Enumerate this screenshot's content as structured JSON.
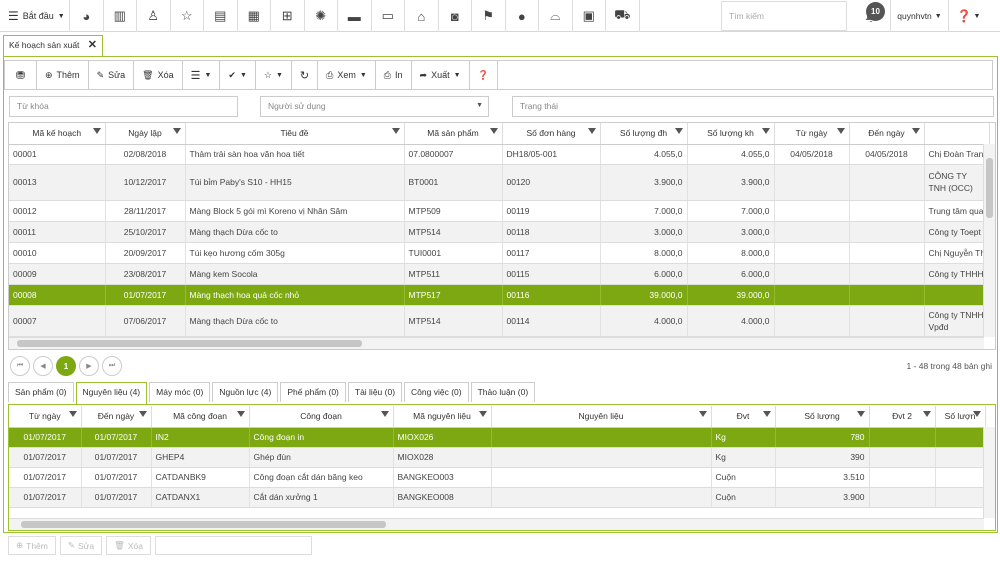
{
  "topbar": {
    "start": "Bắt đầu",
    "search_placeholder": "Tìm kiếm",
    "notifications": "10",
    "user": "quynhvtn",
    "icons": [
      "dashboard-icon",
      "bar-chart-icon",
      "person-outline-icon",
      "star-icon",
      "list-icon",
      "calendar-icon",
      "calendar-plus-icon",
      "spinner-icon",
      "card-icon",
      "credit-card-icon",
      "bank-icon",
      "money-icon",
      "bookmark-icon",
      "user-icon",
      "basket-icon",
      "briefcase-icon",
      "cart-icon"
    ]
  },
  "tab": {
    "label": "Kế hoạch sản xuất"
  },
  "toolbar": {
    "add": "Thêm",
    "edit": "Sửa",
    "delete": "Xóa",
    "view": "Xem",
    "print": "In",
    "export": "Xuất"
  },
  "filters": {
    "keyword": "Từ khóa",
    "user": "Người sử dụng",
    "status": "Trạng thái"
  },
  "grid": {
    "columns": [
      "Mã kế hoạch",
      "Ngày lập",
      "Tiêu đề",
      "Mã sản phẩm",
      "Số đơn hàng",
      "Số lượng đh",
      "Số lượng kh",
      "Từ ngày",
      "Đến ngày",
      ""
    ],
    "rows": [
      [
        "00001",
        "02/08/2018",
        "Thảm trải sàn hoa văn hoa tiết",
        "07.0800007",
        "DH18/05-001",
        "4.055,0",
        "4.055,0",
        "04/05/2018",
        "04/05/2018",
        "Chị Đoàn Tran"
      ],
      [
        "00013",
        "10/12/2017",
        "Túi bỉm Paby's S10 - HH15",
        "BT0001",
        "00120",
        "3.900,0",
        "3.900,0",
        "",
        "",
        "CÔNG TY TNH (OCC)"
      ],
      [
        "00012",
        "28/11/2017",
        "Màng Block 5 gói mì Koreno vị Nhân Sâm",
        "MTP509",
        "00119",
        "7.000,0",
        "7.000,0",
        "",
        "",
        "Trung tâm qua"
      ],
      [
        "00011",
        "25/10/2017",
        "Màng thạch Dừa cốc to",
        "MTP514",
        "00118",
        "3.000,0",
        "3.000,0",
        "",
        "",
        "Công ty Toept"
      ],
      [
        "00010",
        "20/09/2017",
        "Túi kẹo hương cốm 305g",
        "TUI0001",
        "00117",
        "8.000,0",
        "8.000,0",
        "",
        "",
        "Chị Nguyễn Th"
      ],
      [
        "00009",
        "23/08/2017",
        "Màng kem Socola",
        "MTP511",
        "00115",
        "6.000,0",
        "6.000,0",
        "",
        "",
        "Công ty THHH"
      ],
      [
        "00008",
        "01/07/2017",
        "Màng thạch hoa quả cốc nhỏ",
        "MTP517",
        "00116",
        "39.000,0",
        "39.000,0",
        "",
        "",
        ""
      ],
      [
        "00007",
        "07/06/2017",
        "Màng thạch Dừa cốc to",
        "MTP514",
        "00114",
        "4.000,0",
        "4.000,0",
        "",
        "",
        "Công ty TNHH Vpđd"
      ]
    ]
  },
  "pager": {
    "current": "1",
    "info": "1 - 48 trong 48 bản ghi"
  },
  "subtabs": [
    "Sản phẩm (0)",
    "Nguyên liệu (4)",
    "Máy móc (0)",
    "Nguồn lực (4)",
    "Phế phẩm (0)",
    "Tài liệu (0)",
    "Công việc (0)",
    "Thảo luận (0)"
  ],
  "subgrid": {
    "columns": [
      "Từ ngày",
      "Đến ngày",
      "Mã công đoạn",
      "Công đoạn",
      "Mã nguyên liệu",
      "Nguyên liệu",
      "Đvt",
      "Số lượng",
      "Đvt 2",
      "Số lượn"
    ],
    "rows": [
      [
        "01/07/2017",
        "01/07/2017",
        "IN2",
        "Công đoạn in",
        "MIOX026",
        "",
        "Kg",
        "780",
        "",
        ""
      ],
      [
        "01/07/2017",
        "01/07/2017",
        "GHEP4",
        "Ghép đùn",
        "MIOX028",
        "",
        "Kg",
        "390",
        "",
        ""
      ],
      [
        "01/07/2017",
        "01/07/2017",
        "CATDANBK9",
        "Công đoạn cắt dán băng keo",
        "BANGKEO003",
        "",
        "Cuộn",
        "3.510",
        "",
        ""
      ],
      [
        "01/07/2017",
        "01/07/2017",
        "CATDANX1",
        "Cắt dán xưởng 1",
        "BANGKEO008",
        "",
        "Cuộn",
        "3.900",
        "",
        ""
      ]
    ]
  },
  "bottom": {
    "add": "Thêm",
    "edit": "Sửa",
    "delete": "Xóa"
  }
}
